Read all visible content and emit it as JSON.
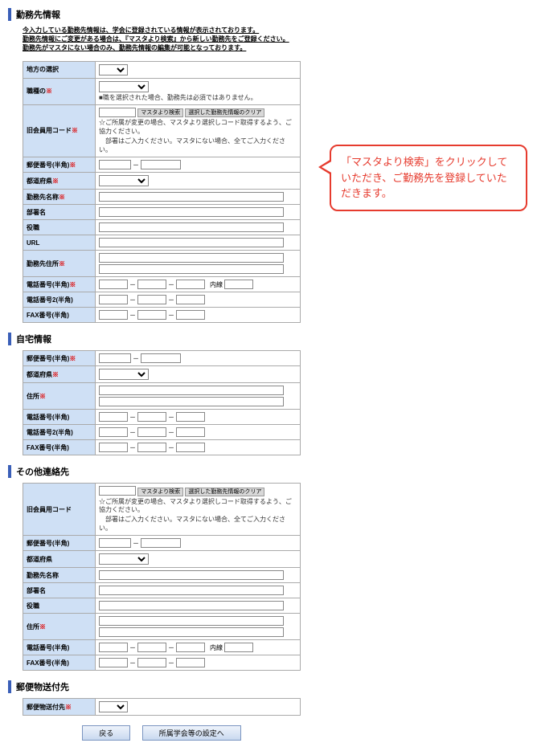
{
  "sections": {
    "work": "勤務先情報",
    "home": "自宅情報",
    "other": "その他連絡先",
    "post": "郵便物送付先"
  },
  "intro": {
    "l1": "今入力している勤務先情報は、学会に登録されている情報が表示されております。",
    "l2": "勤務先情報にご変更がある場合は、『マスタより検索』から新しい勤務先をご登録ください。",
    "l3": "勤務先がマスタにない場合のみ、勤務先情報の編集が可能となっております。"
  },
  "labels": {
    "region": "地方の選択",
    "occupation": "職種の",
    "occupation_note": "■職を選択された場合、勤務先は必須ではありません。",
    "code": "旧会員用コード",
    "master_search": "マスタより検索",
    "clear_select": "選択した勤務先情報のクリア",
    "code_note1": "☆ご所属が変更の場合、マスタより選択しコード取得するよう、ご協力ください。",
    "code_note2": "　部署はご入力ください。マスタにない場合、全てご入力ください。",
    "zip": "郵便番号(半角)",
    "pref": "都道府県",
    "workname": "勤務先名称",
    "dept": "部署名",
    "position": "役職",
    "url": "URL",
    "workaddr": "勤務先住所",
    "tel": "電話番号(半角)",
    "tel2": "電話番号2(半角)",
    "fax": "FAX番号(半角)",
    "naisen": "内線",
    "homeaddr": "住所",
    "postdest": "郵便物送付先",
    "back": "戻る",
    "next": "所属学会等の設定へ"
  },
  "callout": "「マスタより検索」をクリックしていただき、ご勤務先を登録していただきます。"
}
